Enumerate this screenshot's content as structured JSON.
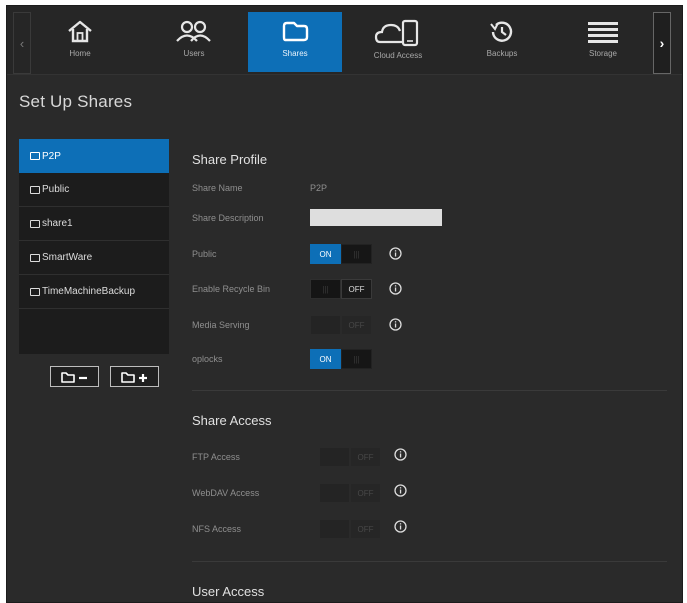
{
  "nav": {
    "tabs": [
      {
        "label": "Home",
        "icon": "home-icon"
      },
      {
        "label": "Users",
        "icon": "users-icon"
      },
      {
        "label": "Shares",
        "icon": "cloud-folder-icon"
      },
      {
        "label": "Cloud Access",
        "icon": "cloud-device-icon"
      },
      {
        "label": "Backups",
        "icon": "history-icon"
      },
      {
        "label": "Storage",
        "icon": "storage-icon"
      }
    ],
    "active_tab": "Shares",
    "prev_glyph": "‹",
    "next_glyph": "›"
  },
  "page": {
    "title": "Set Up Shares"
  },
  "shares": {
    "items": [
      "P2P",
      "Public",
      "share1",
      "SmartWare",
      "TimeMachineBackup"
    ],
    "selected": "P2P"
  },
  "profile": {
    "section_title": "Share Profile",
    "share_name_label": "Share Name",
    "share_name_value": "P2P",
    "share_description_label": "Share Description",
    "share_description_value": "",
    "public_label": "Public",
    "public_on": "ON",
    "recycle_label": "Enable Recycle Bin",
    "recycle_off": "OFF",
    "media_label": "Media Serving",
    "media_off": "OFF",
    "oplocks_label": "oplocks",
    "oplocks_on": "ON"
  },
  "access": {
    "section_title": "Share Access",
    "ftp_label": "FTP Access",
    "ftp_off": "OFF",
    "webdav_label": "WebDAV Access",
    "webdav_off": "OFF",
    "nfs_label": "NFS Access",
    "nfs_off": "OFF"
  },
  "user_access": {
    "section_title": "User Access"
  },
  "colors": {
    "accent": "#0d6fb7",
    "background": "#2a2a2a",
    "panel": "#1c1c1c"
  }
}
